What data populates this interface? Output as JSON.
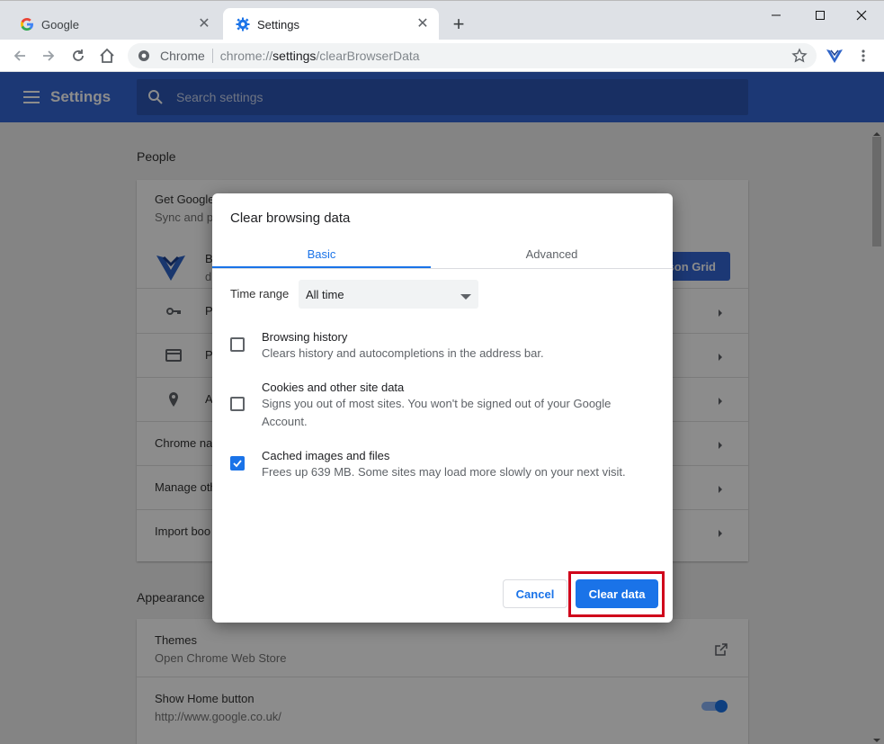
{
  "browser": {
    "tabs": [
      {
        "title": "Google",
        "icon": "google-icon"
      },
      {
        "title": "Settings",
        "icon": "gear-icon"
      }
    ],
    "new_tab_symbol": "+",
    "omnibox": {
      "chip": "Chrome",
      "url_scheme": "chrome://",
      "url_host": "settings",
      "url_path": "/clearBrowserData"
    }
  },
  "settings": {
    "title": "Settings",
    "search_placeholder": "Search settings",
    "people_section": "People",
    "rows": {
      "get_google": "Get Google",
      "sync_and": "Sync and p",
      "profile_b": "B",
      "profile_d": "d",
      "sync_button": "son Grid",
      "passwords": "P",
      "payments": "P",
      "addresses": "A",
      "chrome_name": "Chrome na",
      "manage_other": "Manage oth",
      "import_bookmarks": "Import boo"
    },
    "appearance_section": "Appearance",
    "themes": {
      "label": "Themes",
      "sub": "Open Chrome Web Store"
    },
    "home_button": {
      "label": "Show Home button",
      "sub": "http://www.google.co.uk/",
      "enabled": true
    }
  },
  "dialog": {
    "title": "Clear browsing data",
    "tabs": {
      "basic": "Basic",
      "advanced": "Advanced"
    },
    "time_range_label": "Time range",
    "time_range_value": "All time",
    "options": [
      {
        "title": "Browsing history",
        "desc": "Clears history and autocompletions in the address bar.",
        "checked": false
      },
      {
        "title": "Cookies and other site data",
        "desc": "Signs you out of most sites. You won't be signed out of your Google Account.",
        "checked": false
      },
      {
        "title": "Cached images and files",
        "desc": "Frees up 639 MB. Some sites may load more slowly on your next visit.",
        "checked": true
      }
    ],
    "cancel_label": "Cancel",
    "clear_label": "Clear data"
  },
  "colors": {
    "accent": "#1a73e8",
    "header": "#3367d6",
    "highlight": "#d0021b"
  }
}
